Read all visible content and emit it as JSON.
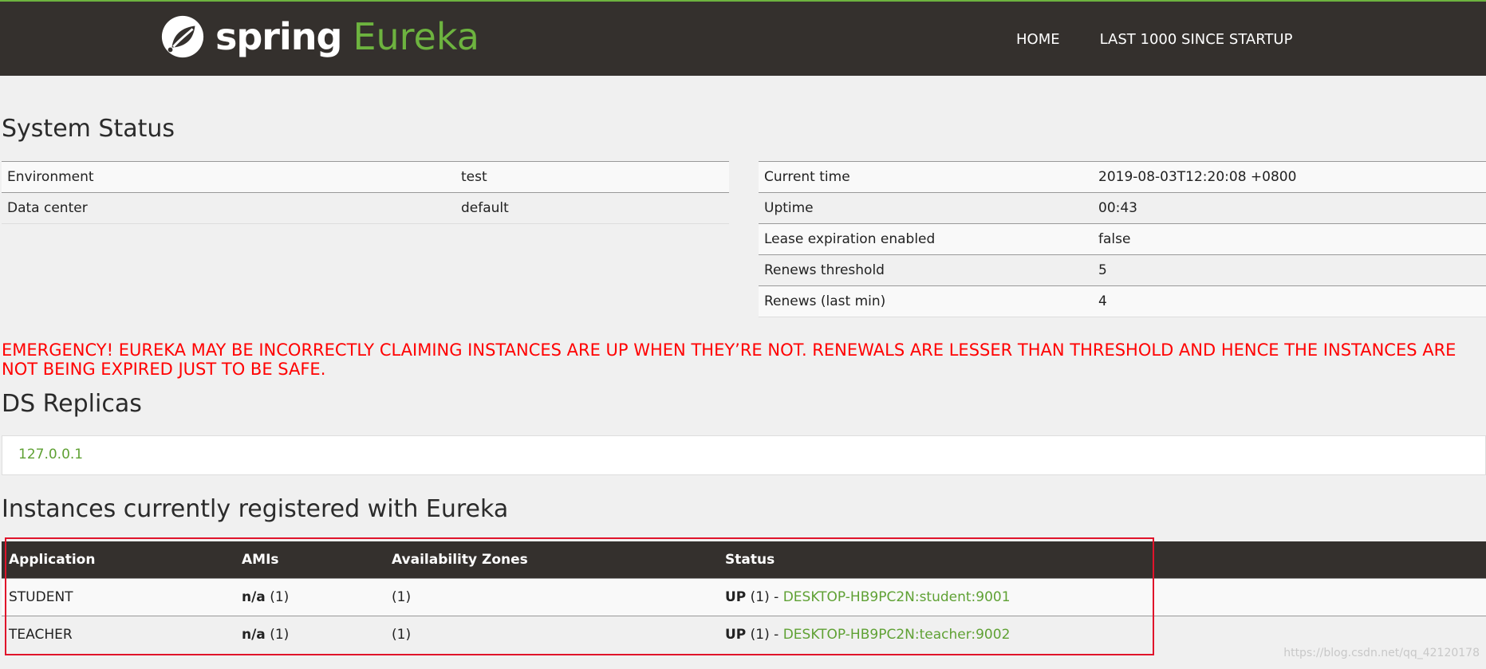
{
  "navbar": {
    "brand_word1": "spring",
    "brand_word2": "Eureka",
    "links": [
      "HOME",
      "LAST 1000 SINCE STARTUP"
    ]
  },
  "system_status": {
    "title": "System Status",
    "left": [
      {
        "key": "Environment",
        "value": "test"
      },
      {
        "key": "Data center",
        "value": "default"
      }
    ],
    "right": [
      {
        "key": "Current time",
        "value": "2019-08-03T12:20:08 +0800"
      },
      {
        "key": "Uptime",
        "value": "00:43"
      },
      {
        "key": "Lease expiration enabled",
        "value": "false"
      },
      {
        "key": "Renews threshold",
        "value": "5"
      },
      {
        "key": "Renews (last min)",
        "value": "4"
      }
    ]
  },
  "emergency": "EMERGENCY! EUREKA MAY BE INCORRECTLY CLAIMING INSTANCES ARE UP WHEN THEY’RE NOT. RENEWALS ARE LESSER THAN THRESHOLD AND HENCE THE INSTANCES ARE NOT BEING EXPIRED JUST TO BE SAFE.",
  "replicas": {
    "title": "DS Replicas",
    "items": [
      "127.0.0.1"
    ]
  },
  "instances": {
    "title": "Instances currently registered with Eureka",
    "headers": [
      "Application",
      "AMIs",
      "Availability Zones",
      "Status"
    ],
    "rows": [
      {
        "app": "STUDENT",
        "ami_bold": "n/a",
        "ami_count": "(1)",
        "zones": "(1)",
        "status_bold": "UP",
        "status_count": "(1) -",
        "instance": "DESKTOP-HB9PC2N:student:9001"
      },
      {
        "app": "TEACHER",
        "ami_bold": "n/a",
        "ami_count": "(1)",
        "zones": "(1)",
        "status_bold": "UP",
        "status_count": "(1) -",
        "instance": "DESKTOP-HB9PC2N:teacher:9002"
      }
    ]
  },
  "watermark": "https://blog.csdn.net/qq_42120178",
  "colors": {
    "nav_bg": "#34302d",
    "accent_green": "#6db33f",
    "emergency_red": "#ff0000",
    "highlight_red": "#e0142b"
  }
}
